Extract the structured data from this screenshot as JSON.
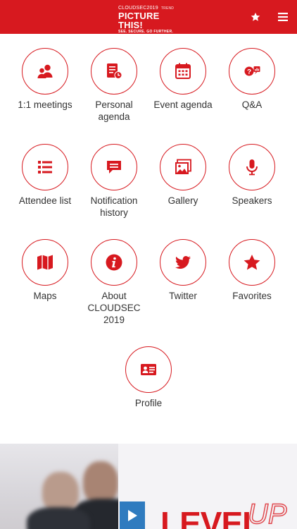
{
  "header": {
    "logo_line1": "CLOUDSEC2019",
    "logo_line1_small": "TREND",
    "logo_line2": "PICTURE THIS!",
    "logo_line3": "SEE. SECURE. GO FURTHER.",
    "favorite_icon": "star-icon",
    "menu_icon": "hamburger-menu-icon"
  },
  "colors": {
    "brand_red": "#d7191f",
    "label_text": "#333333"
  },
  "tiles": [
    {
      "label": "1:1 meetings",
      "icon": "users-icon"
    },
    {
      "label": "Personal agenda",
      "icon": "personal-agenda-icon"
    },
    {
      "label": "Event agenda",
      "icon": "calendar-icon"
    },
    {
      "label": "Q&A",
      "icon": "qa-icon"
    },
    {
      "label": "Attendee list",
      "icon": "list-icon"
    },
    {
      "label": "Notification history",
      "icon": "message-icon"
    },
    {
      "label": "Gallery",
      "icon": "gallery-icon"
    },
    {
      "label": "Speakers",
      "icon": "microphone-icon"
    },
    {
      "label": "Maps",
      "icon": "map-icon"
    },
    {
      "label": "About CLOUDSEC 2019",
      "icon": "info-icon"
    },
    {
      "label": "Twitter",
      "icon": "twitter-icon"
    },
    {
      "label": "Favorites",
      "icon": "star-icon"
    },
    {
      "label": "Profile",
      "icon": "id-card-icon"
    }
  ],
  "banner": {
    "text_level": "LEVEL",
    "text_up": "UP",
    "play_icon": "play-icon"
  }
}
